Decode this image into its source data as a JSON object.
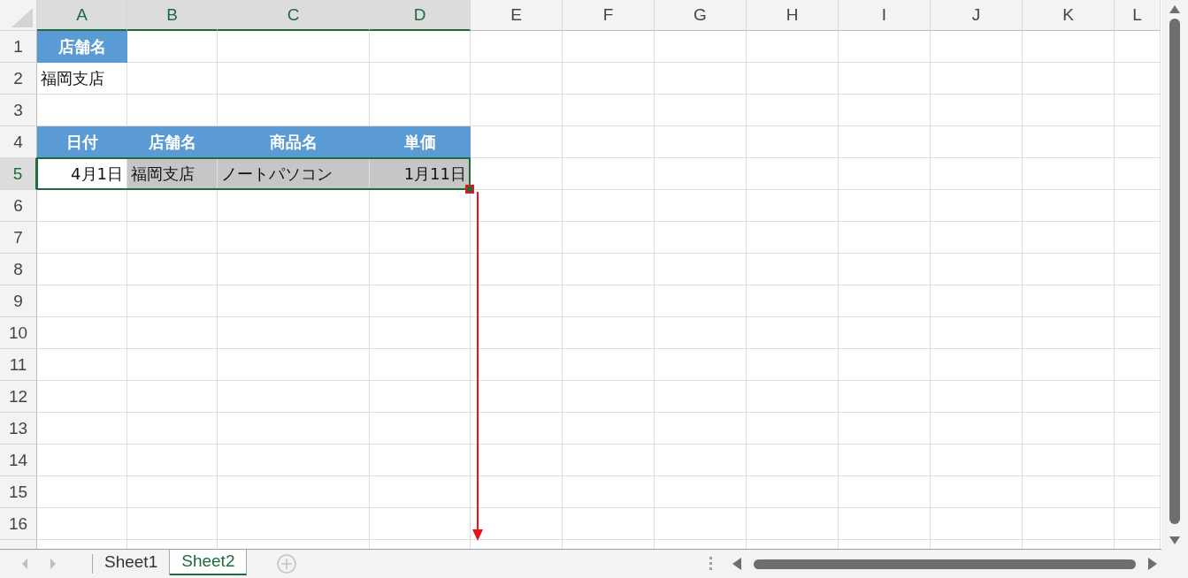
{
  "columns": [
    {
      "label": "A",
      "selected": true
    },
    {
      "label": "B",
      "selected": true
    },
    {
      "label": "C",
      "selected": true
    },
    {
      "label": "D",
      "selected": true
    },
    {
      "label": "E",
      "selected": false
    },
    {
      "label": "F",
      "selected": false
    },
    {
      "label": "G",
      "selected": false
    },
    {
      "label": "H",
      "selected": false
    },
    {
      "label": "I",
      "selected": false
    },
    {
      "label": "J",
      "selected": false
    },
    {
      "label": "K",
      "selected": false
    },
    {
      "label": "L",
      "selected": false
    }
  ],
  "rows": [
    {
      "label": "1",
      "selected": false,
      "cells": [
        {
          "text": "店舗名",
          "kind": "header",
          "selected": false
        }
      ]
    },
    {
      "label": "2",
      "selected": false,
      "cells": [
        {
          "text": "福岡支店",
          "kind": "text",
          "selected": false
        }
      ]
    },
    {
      "label": "3",
      "selected": false,
      "cells": []
    },
    {
      "label": "4",
      "selected": false,
      "cells": [
        {
          "text": "日付",
          "kind": "header",
          "selected": false
        },
        {
          "text": "店舗名",
          "kind": "header",
          "selected": false
        },
        {
          "text": "商品名",
          "kind": "header",
          "selected": false
        },
        {
          "text": "単価",
          "kind": "header",
          "selected": false
        }
      ]
    },
    {
      "label": "5",
      "selected": true,
      "cells": [
        {
          "text": "4月1日",
          "kind": "date",
          "selected": true,
          "active": true
        },
        {
          "text": "福岡支店",
          "kind": "text",
          "selected": true,
          "active": false
        },
        {
          "text": "ノートパソコン",
          "kind": "text",
          "selected": true,
          "active": false
        },
        {
          "text": "1月11日",
          "kind": "date",
          "selected": true,
          "active": false
        }
      ]
    },
    {
      "label": "6",
      "selected": false,
      "cells": []
    },
    {
      "label": "7",
      "selected": false,
      "cells": []
    },
    {
      "label": "8",
      "selected": false,
      "cells": []
    },
    {
      "label": "9",
      "selected": false,
      "cells": []
    },
    {
      "label": "10",
      "selected": false,
      "cells": []
    },
    {
      "label": "11",
      "selected": false,
      "cells": []
    },
    {
      "label": "12",
      "selected": false,
      "cells": []
    },
    {
      "label": "13",
      "selected": false,
      "cells": []
    },
    {
      "label": "14",
      "selected": false,
      "cells": []
    },
    {
      "label": "15",
      "selected": false,
      "cells": []
    },
    {
      "label": "16",
      "selected": false,
      "cells": []
    }
  ],
  "sheet_tabs": [
    {
      "label": "Sheet1",
      "selected": false
    },
    {
      "label": "Sheet2",
      "selected": true
    }
  ]
}
